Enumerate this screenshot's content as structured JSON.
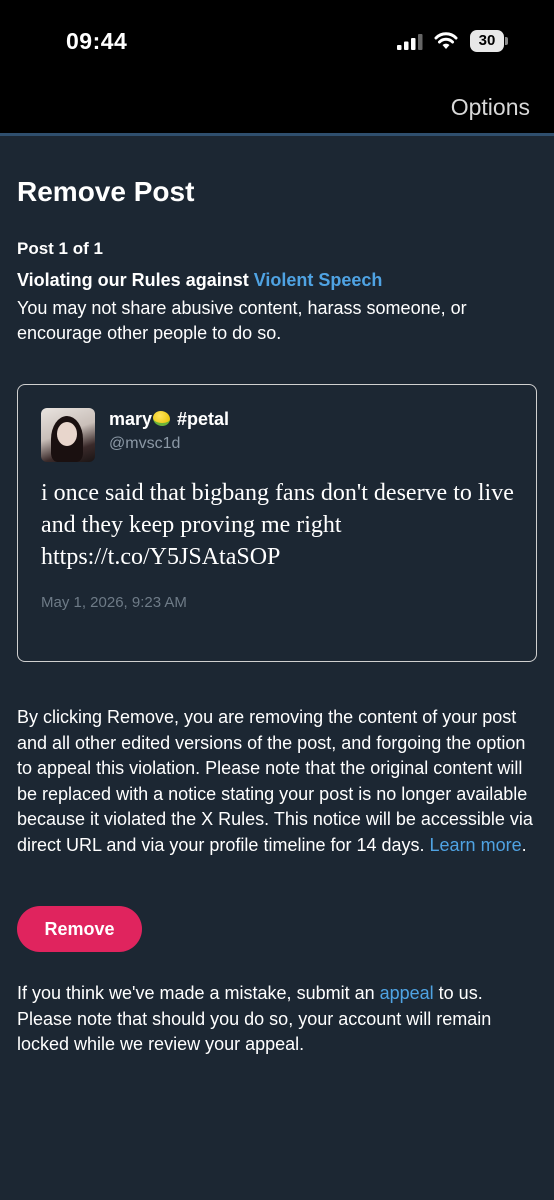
{
  "status_bar": {
    "time": "09:44",
    "battery": "30",
    "icons": [
      "signal-icon",
      "wifi-icon",
      "battery-icon"
    ]
  },
  "header": {
    "options_label": "Options"
  },
  "page": {
    "title": "Remove Post",
    "post_counter": "Post 1 of 1",
    "violation_prefix": "Violating our Rules against ",
    "violation_link": "Violent Speech",
    "violation_description": "You may not share abusive content, harass someone, or encourage other people to do so."
  },
  "tweet": {
    "display_name_start": "mary",
    "display_name_end": " #petal",
    "emoji": "lemon-icon",
    "handle": "@mvsc1d",
    "text": "i once said that bigbang fans don't deserve to live and they keep proving me right https://t.co/Y5JSAtaSOP",
    "date": "May 1, 2026, 9:23 AM"
  },
  "notice": {
    "text": "By clicking Remove, you are removing the content of your post and all other edited versions of the post, and forgoing the option to appeal this violation. Please note that the original content will be replaced with a notice stating your post is no longer available because it violated the X Rules. This notice will be accessible via direct URL and via your profile timeline for 14 days. ",
    "learn_more": "Learn more",
    "end": "."
  },
  "remove_button_label": "Remove",
  "appeal_note": {
    "before": "If you think we've made a mistake, submit an ",
    "link": "appeal",
    "after": " to us. Please note that should you do so, your account will remain locked while we review your appeal."
  },
  "colors": {
    "background": "#1c2733",
    "link": "#4fa3e3",
    "remove_button": "#e0245e"
  }
}
